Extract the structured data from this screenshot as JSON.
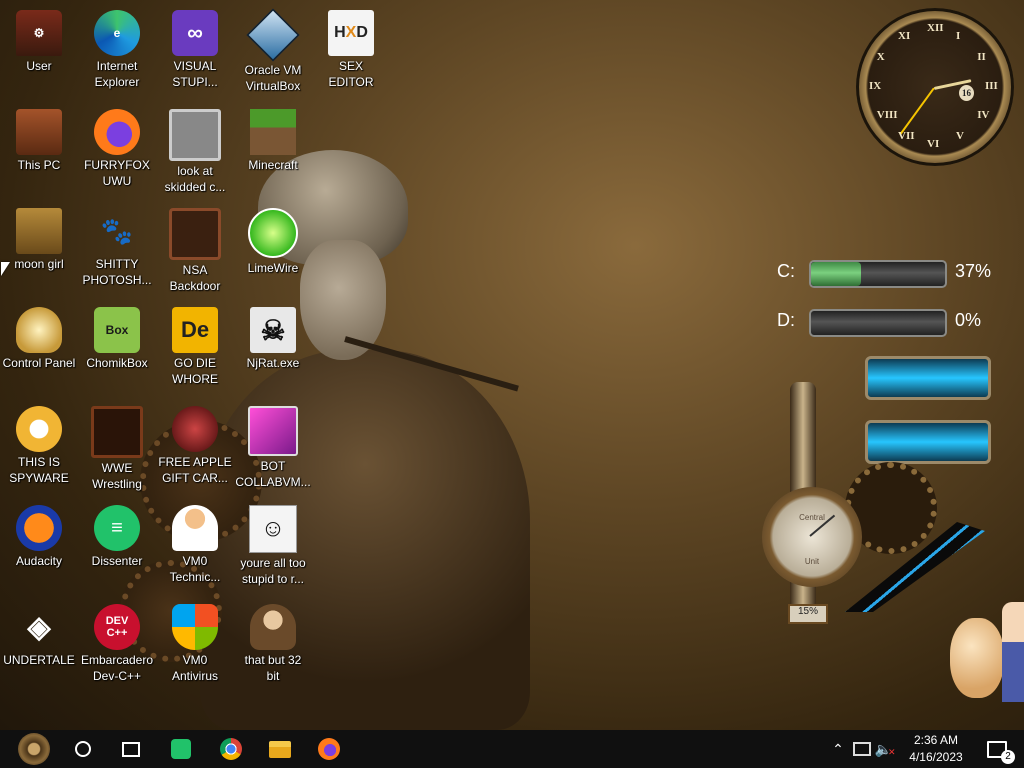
{
  "desktop": {
    "icons": [
      {
        "label": "User"
      },
      {
        "label": "Internet\nExplorer"
      },
      {
        "label": "VISUAL\nSTUPI..."
      },
      {
        "label": "Oracle VM\nVirtualBox"
      },
      {
        "label": "SEX\nEDITOR"
      },
      {
        "label": "This PC"
      },
      {
        "label": "FURRYFOX\nUWU"
      },
      {
        "label": "look at\nskidded c..."
      },
      {
        "label": "Minecraft"
      },
      {
        "label": "moon girl"
      },
      {
        "label": "SHITTY\nPHOTOSH..."
      },
      {
        "label": "NSA\nBackdoor"
      },
      {
        "label": "LimeWire"
      },
      {
        "label": "Control Panel"
      },
      {
        "label": "ChomikBox"
      },
      {
        "label": "GO DIE\nWHORE"
      },
      {
        "label": "NjRat.exe"
      },
      {
        "label": "THIS IS\nSPYWARE"
      },
      {
        "label": "WWE\nWrestling"
      },
      {
        "label": "FREE APPLE\nGIFT CAR..."
      },
      {
        "label": "BOT\nCOLLABVM..."
      },
      {
        "label": "Audacity"
      },
      {
        "label": "Dissenter"
      },
      {
        "label": "VM0\nTechnic..."
      },
      {
        "label": "youre all too\nstupid to r..."
      },
      {
        "label": "UNDERTALE"
      },
      {
        "label": "Embarcadero\nDev-C++"
      },
      {
        "label": "VM0\nAntivirus"
      },
      {
        "label": "that but 32\nbit"
      }
    ]
  },
  "widgets": {
    "clock": {
      "numerals": [
        "XII",
        "I",
        "II",
        "III",
        "IV",
        "V",
        "VI",
        "VII",
        "VIII",
        "IX",
        "X",
        "XI"
      ],
      "date_dial": "16",
      "hour": 2,
      "minute": 36
    },
    "drives": [
      {
        "letter": "C:",
        "percent_text": "37%",
        "used": 0.37
      },
      {
        "letter": "D:",
        "percent_text": "0%",
        "used": 0.0
      }
    ],
    "gauge": {
      "face_text_top": "Central",
      "face_text_bottom": "Unit",
      "percent_text": "15%"
    }
  },
  "taskbar": {
    "time": "2:36 AM",
    "date": "4/16/2023",
    "notification_count": "2",
    "pinned": [
      "start",
      "cortana",
      "task-view",
      "dissenter",
      "chrome",
      "file-explorer",
      "firefox"
    ]
  },
  "colors": {
    "taskbar": "#101010",
    "drive_fill": "#5fbf66",
    "tank": "#27c6ff"
  }
}
